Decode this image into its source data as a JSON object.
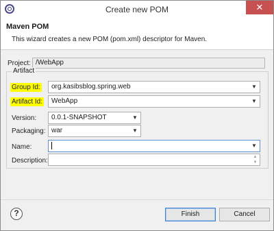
{
  "window": {
    "title": "Create new POM",
    "close_glyph": "✕"
  },
  "banner": {
    "title": "Maven POM",
    "description": "This wizard creates a new POM (pom.xml) descriptor for Maven."
  },
  "project": {
    "label": "Project:",
    "value": "/WebApp"
  },
  "artifact": {
    "group_label": "Artifact",
    "highlight_color": "#ffff00",
    "group_id": {
      "label": "Group Id:",
      "value": "org.kasibsblog.spring.web"
    },
    "artifact_id": {
      "label": "Artifact Id:",
      "value": "WebApp"
    },
    "version": {
      "label": "Version:",
      "value": "0.0.1-SNAPSHOT"
    },
    "packaging": {
      "label": "Packaging:",
      "value": "war"
    },
    "name": {
      "label": "Name:",
      "value": ""
    },
    "description": {
      "label": "Description:",
      "value": ""
    }
  },
  "footer": {
    "help_glyph": "?",
    "finish_label": "Finish",
    "cancel_label": "Cancel"
  },
  "icons": {
    "app": "eclipse-icon",
    "dropdown": "chevron-down-icon",
    "help": "help-icon",
    "spinner": "spinner-icon"
  }
}
